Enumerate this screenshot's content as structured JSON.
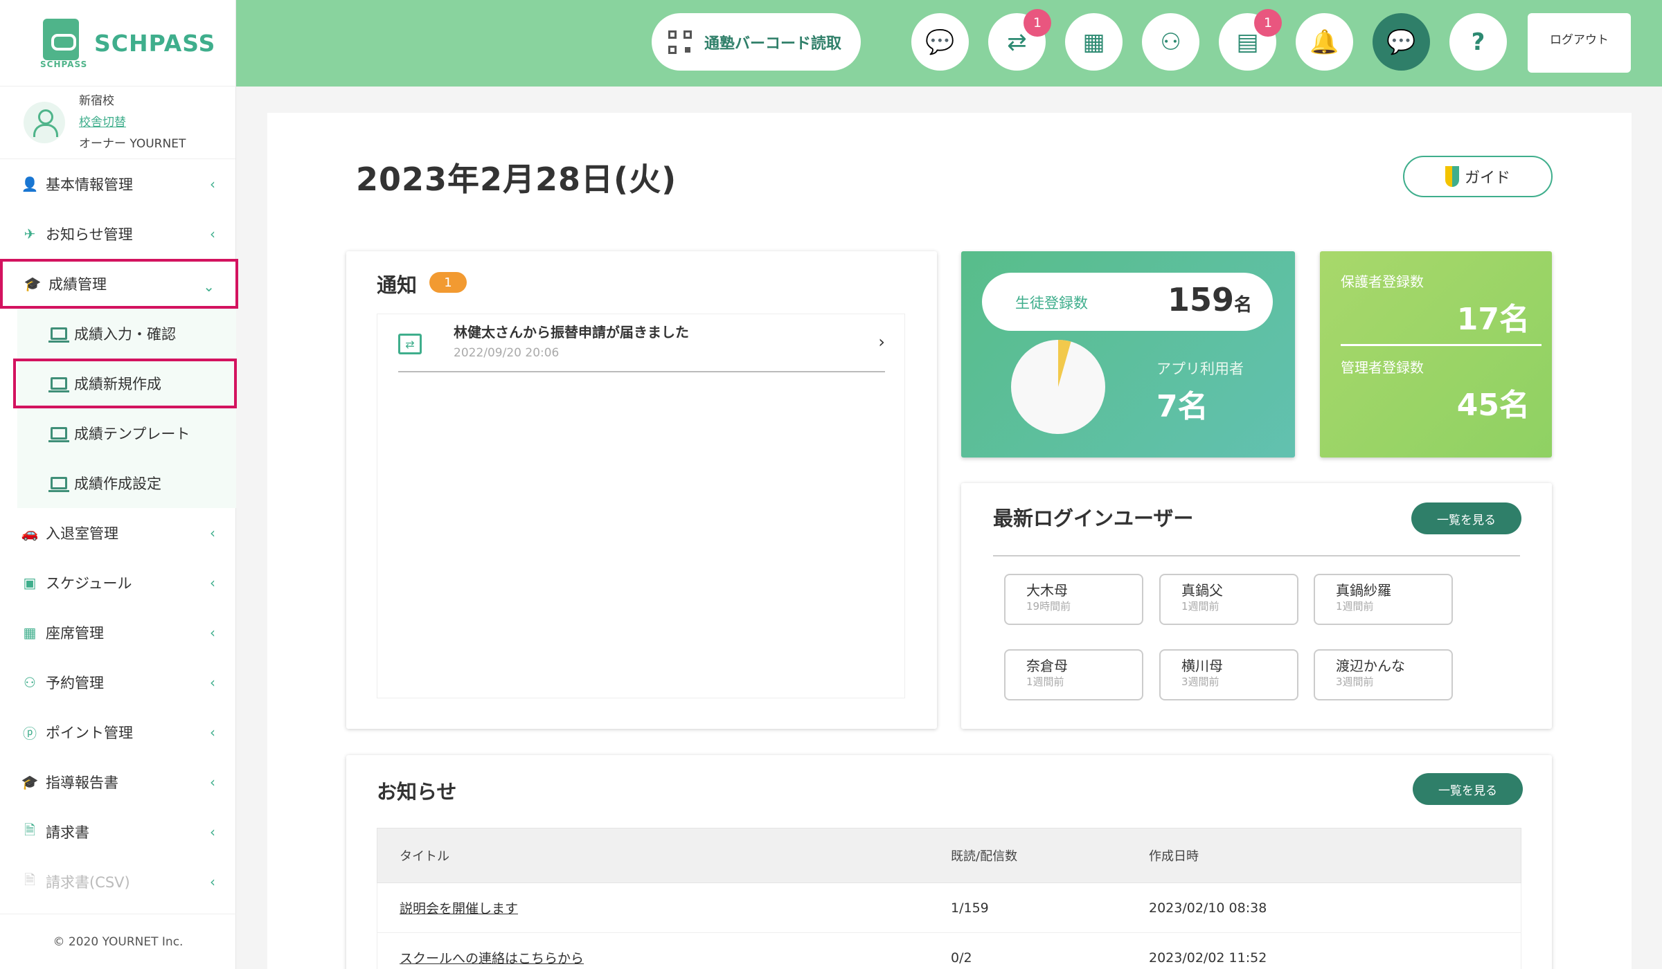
{
  "brand": {
    "name": "SCHPASS",
    "small": "SCHPASS"
  },
  "school": {
    "name": "新宿校",
    "switch_link": "校舎切替",
    "owner": "オーナー YOURNET"
  },
  "sidebar": {
    "items": [
      {
        "label": "基本情報管理"
      },
      {
        "label": "お知らせ管理"
      },
      {
        "label": "成績管理"
      },
      {
        "label": "入退室管理"
      },
      {
        "label": "スケジュール"
      },
      {
        "label": "座席管理"
      },
      {
        "label": "予約管理"
      },
      {
        "label": "ポイント管理"
      },
      {
        "label": "指導報告書"
      },
      {
        "label": "請求書"
      },
      {
        "label": "請求書(CSV)"
      }
    ],
    "sub_items": [
      {
        "label": "成績入力・確認"
      },
      {
        "label": "成績新規作成"
      },
      {
        "label": "成績テンプレート"
      },
      {
        "label": "成績作成設定"
      }
    ],
    "copyright": "© 2020 YOURNET Inc."
  },
  "topbar": {
    "barcode_label": "通塾バーコード読取",
    "transfer_badge": "1",
    "gift_badge": "1",
    "logout_label": "ログアウト"
  },
  "main": {
    "date_title": "2023年2月28日(火)",
    "guide_label": "ガイド"
  },
  "notifications": {
    "title": "通知",
    "count": "1",
    "items": [
      {
        "text": "林健太さんから振替申請が届きました",
        "date": "2022/09/20 20:06"
      }
    ]
  },
  "stats": {
    "students_label": "生徒登録数",
    "students_count": "159",
    "students_unit": "名",
    "app_users_label": "アプリ利用者",
    "app_users_count": "7名",
    "app_users_fraction": 0.044,
    "guardians_label": "保護者登録数",
    "guardians_count": "17名",
    "admins_label": "管理者登録数",
    "admins_count": "45名"
  },
  "recent_login": {
    "title": "最新ログインユーザー",
    "view_all": "一覧を見る",
    "users": [
      {
        "name": "大木母",
        "time": "19時間前"
      },
      {
        "name": "真鍋父",
        "time": "1週間前"
      },
      {
        "name": "真鍋紗羅",
        "time": "1週間前"
      },
      {
        "name": "奈倉母",
        "time": "1週間前"
      },
      {
        "name": "横川母",
        "time": "3週間前"
      },
      {
        "name": "渡辺かんな",
        "time": "3週間前"
      }
    ]
  },
  "news": {
    "title": "お知らせ",
    "view_all": "一覧を見る",
    "headers": {
      "title": "タイトル",
      "read": "既読/配信数",
      "created": "作成日時"
    },
    "rows": [
      {
        "title": "説明会を開催します",
        "read": "1/159",
        "created": "2023/02/10 08:38"
      },
      {
        "title": "スクールへの連絡はこちらから",
        "read": "0/2",
        "created": "2023/02/02 11:52"
      }
    ]
  },
  "colors": {
    "accent": "#3fae8c",
    "topbar": "#89d39e",
    "highlight": "#d3135f",
    "badge": "#e9567f"
  }
}
